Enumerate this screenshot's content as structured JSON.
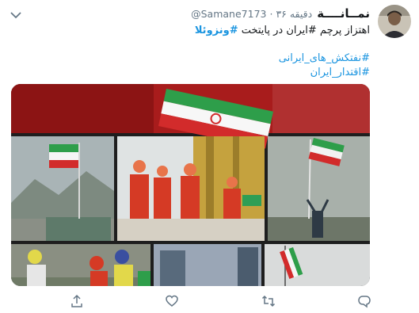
{
  "tweet": {
    "display_name": "نمــانــــة",
    "handle": "@Samane7173",
    "separator": "·",
    "time": "۳۶ دقیقه",
    "text_main": "اهتزاز پرچم #ایران در پایتخت ",
    "text_hashtag_bold": "#ونزوئلا",
    "hashtags": [
      "#نفتکش_های_ایرانی",
      "#اقتدار_ایران"
    ]
  },
  "media": {
    "description_icons": [
      "flag-iran",
      "tanker-crew",
      "flagpole"
    ]
  },
  "actions": {
    "reply_icon": "reply-icon",
    "retweet_icon": "retweet-icon",
    "like_icon": "like-icon",
    "share_icon": "share-icon"
  },
  "colors": {
    "link": "#1b95e0",
    "text": "#14171a",
    "muted": "#657786"
  }
}
